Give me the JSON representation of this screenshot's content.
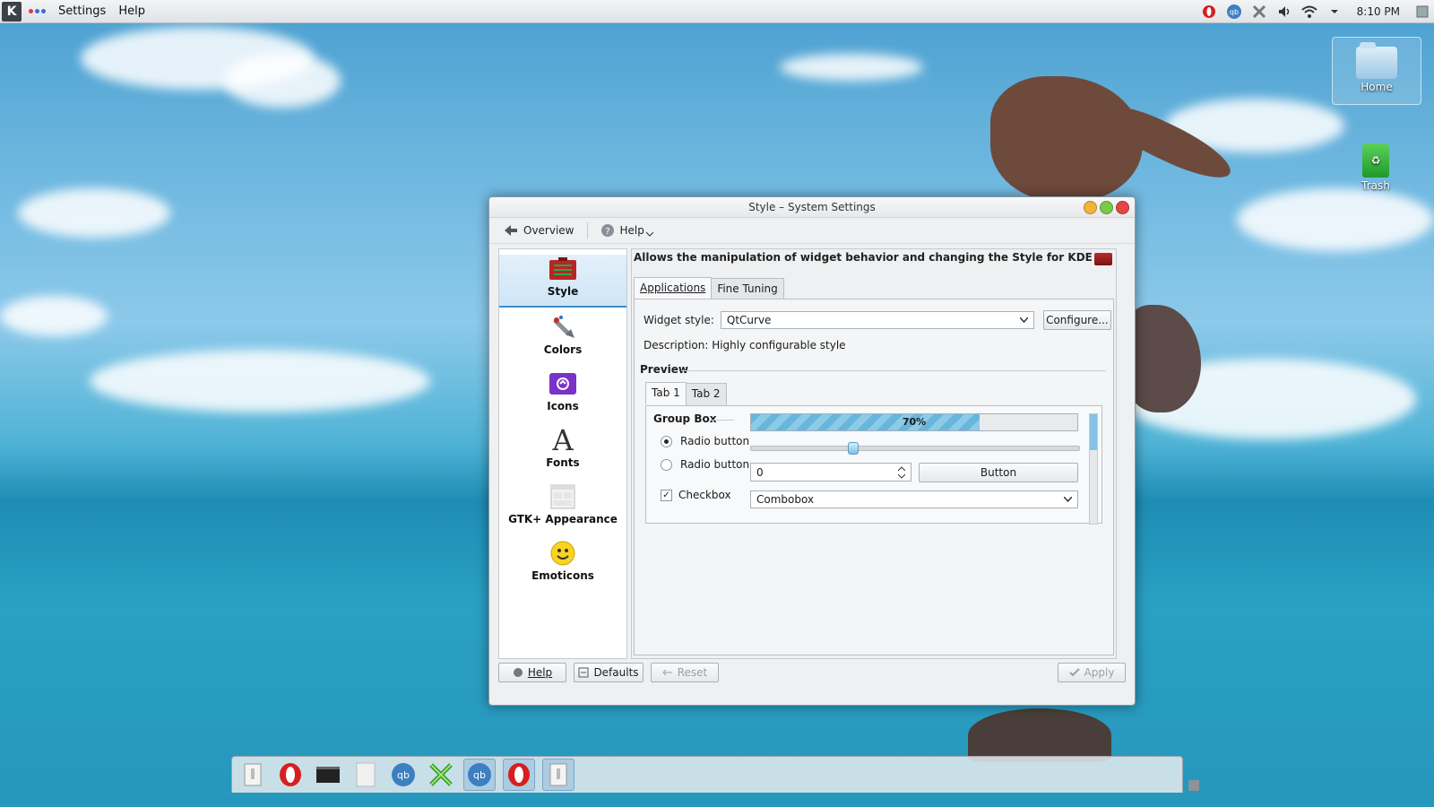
{
  "top_panel": {
    "logo_glyph": "K",
    "menus": [
      "Settings",
      "Help"
    ],
    "clock": "8:10 PM",
    "tray_icons": [
      "opera-icon",
      "qbittorrent-icon",
      "xchat-icon",
      "volume-icon",
      "wifi-icon",
      "tray-expand-icon"
    ]
  },
  "desktop": {
    "home_label": "Home",
    "trash_label": "Trash"
  },
  "window": {
    "title": "Style – System Settings",
    "toolbar": {
      "overview": "Overview",
      "help": "Help"
    },
    "categories": [
      {
        "label": "Style",
        "icon": "style-icon",
        "selected": true
      },
      {
        "label": "Colors",
        "icon": "colors-icon"
      },
      {
        "label": "Icons",
        "icon": "icons-icon"
      },
      {
        "label": "Fonts",
        "icon": "fonts-icon"
      },
      {
        "label": "GTK+ Appearance",
        "icon": "gtk-icon"
      },
      {
        "label": "Emoticons",
        "icon": "emoticons-icon"
      }
    ],
    "header": "Allows the manipulation of widget behavior and changing the Style for KDE",
    "tabs": [
      "Applications",
      "Fine Tuning"
    ],
    "widget_style_label": "Widget style:",
    "widget_style_value": "QtCurve",
    "configure_button": "Configure...",
    "description": "Description: Highly configurable style",
    "preview_label": "Preview",
    "preview": {
      "tabs": [
        "Tab 1",
        "Tab 2"
      ],
      "group_box": "Group Box",
      "progress_value": 0.7,
      "progress_text": "70%",
      "slider_value": 0.31,
      "radio1": "Radio button",
      "radio2": "Radio button",
      "spin_value": "0",
      "button": "Button",
      "checkbox": "Checkbox",
      "combobox": "Combobox"
    },
    "footer": {
      "help": "Help",
      "defaults": "Defaults",
      "reset": "Reset",
      "apply": "Apply"
    }
  },
  "taskbar": {
    "apps": [
      "window-icon",
      "opera-icon",
      "terminal-icon",
      "document-icon",
      "qbittorrent-icon",
      "xchat-icon",
      "qbittorrent-icon",
      "opera-icon",
      "window-icon"
    ]
  }
}
